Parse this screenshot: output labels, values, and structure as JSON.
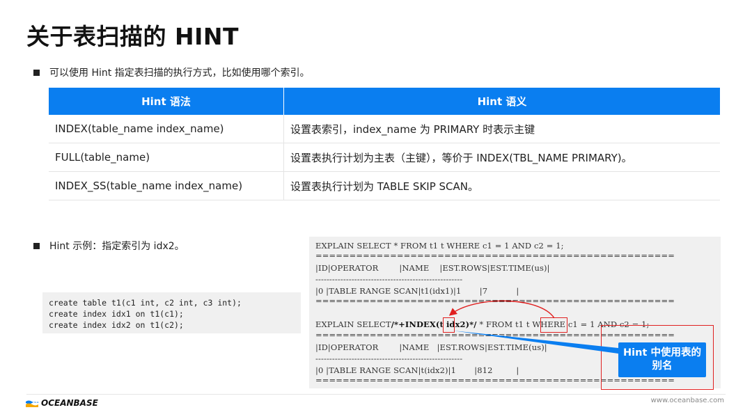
{
  "title": "关于表扫描的 HINT",
  "bullet1": "可以使用 Hint 指定表扫描的执行方式，比如使用哪个索引。",
  "table": {
    "headers": [
      "Hint 语法",
      "Hint 语义"
    ],
    "rows": [
      [
        "INDEX(table_name index_name)",
        "设置表索引，index_name 为 PRIMARY 时表示主键"
      ],
      [
        "FULL(table_name)",
        "设置表执行计划为主表（主键），等价于 INDEX(TBL_NAME PRIMARY)。"
      ],
      [
        "INDEX_SS(table_name index_name)",
        "设置表执行计划为 TABLE SKIP SCAN。"
      ]
    ]
  },
  "bullet2": "Hint 示例：指定索引为 idx2。",
  "code_left": [
    "create table t1(c1 int, c2 int, c3 int);",
    "create index idx1 on t1(c1);",
    "create index idx2 on t1(c2);"
  ],
  "code_right": {
    "l1": "EXPLAIN SELECT * FROM t1 t WHERE c1 = 1 AND c2 = 1;",
    "sep_eq": "=====================================================",
    "sep_dash": "-----------------------------------------------------",
    "hdr1": "|ID|OPERATOR        |NAME    |EST.ROWS|EST.TIME(us)|",
    "row1": "|0 |TABLE RANGE SCAN|t1(idx1)|1       |7           |",
    "l2_pre": "EXPLAIN SELECT",
    "l2_hint": "/*+INDEX(t idx2)*/",
    "l2_post": " * FROM t1 t WHERE c1 = 1 AND c2 = 1;",
    "hdr2": "|ID|OPERATOR        |NAME   |EST.ROWS|EST.TIME(us)|",
    "row2": "|0 |TABLE RANGE SCAN|t(idx2)|1       |812         |"
  },
  "callout": "Hint 中使用表的别名",
  "footer": {
    "logo_text": "OCEANBASE",
    "url": "www.oceanbase.com"
  },
  "colors": {
    "accent": "#0a7ef0",
    "highlight": "#e02020"
  }
}
